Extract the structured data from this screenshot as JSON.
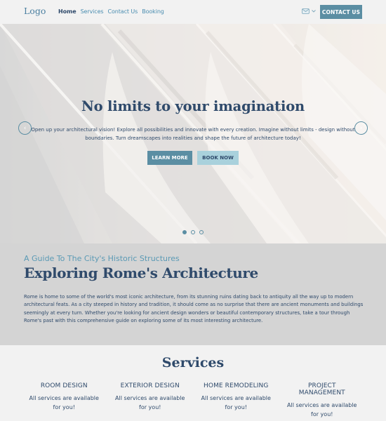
{
  "header": {
    "logo": "Logo",
    "nav": [
      {
        "label": "Home",
        "active": true
      },
      {
        "label": "Services",
        "active": false
      },
      {
        "label": "Contact Us",
        "active": false
      },
      {
        "label": "Booking",
        "active": false
      }
    ],
    "language_icon": "flag-icon",
    "contact_button": "CONTACT US"
  },
  "hero": {
    "title": "No limits to your imagination",
    "text": "Open up your architectural vision! Explore all possibilities and innovate with every creation. Imagine without limits - design without boundaries. Turn dreamscapes into realities and shape the future of architecture today!",
    "primary_button": "LEARN MORE",
    "secondary_button": "BOOK NOW",
    "prev_icon": "‹",
    "next_icon": "›",
    "slides": 3,
    "active_slide": 1
  },
  "about": {
    "subtitle": "A Guide To The City's Historic Structures",
    "title": "Exploring Rome's Architecture",
    "text": "Rome is home to some of the world's most iconic architecture, from its stunning ruins dating back to antiquity all the way up to modern architectural feats. As a city steeped in history and tradition, it should come as no surprise that there are ancient monuments and buildings seemingly at every turn. Whether you're looking for ancient design wonders or beautiful contemporary structures, take a tour through Rome's past with this comprehensive guide on exploring some of its most interesting architecture."
  },
  "services": {
    "title": "Services",
    "items": [
      {
        "name": "ROOM DESIGN",
        "description": "All services are available for you!"
      },
      {
        "name": "EXTERIOR DESIGN",
        "description": "All services are available for you!"
      },
      {
        "name": "HOME REMODELING",
        "description": "All services are available for you!"
      },
      {
        "name": "PROJECT MANAGEMENT",
        "description": "All services are available for you!"
      }
    ]
  },
  "colors": {
    "primary": "#5b8ea3",
    "secondary": "#a9d1dc",
    "text": "#2f4a6b",
    "accent_text": "#5b9ab5"
  }
}
